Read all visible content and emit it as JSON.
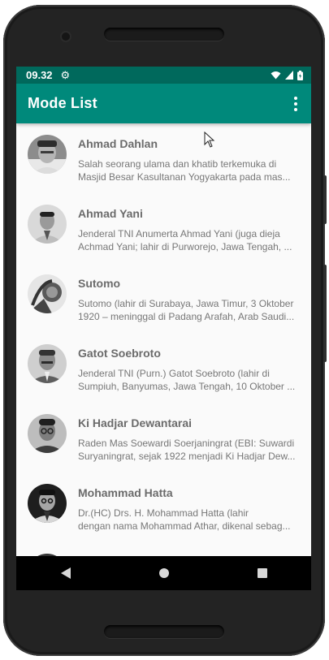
{
  "statusbar": {
    "time": "09.32",
    "icons": [
      "settings-gear-icon",
      "wifi-icon",
      "signal-icon",
      "battery-icon"
    ]
  },
  "appbar": {
    "title": "Mode List",
    "menu_icon": "more-vertical-icon"
  },
  "items": [
    {
      "name": "Ahmad Dahlan",
      "line1": "Salah seorang ulama dan khatib terkemuka di",
      "line2": "Masjid Besar Kasultanan Yogyakarta pada mas..."
    },
    {
      "name": "Ahmad Yani",
      "line1": "Jenderal TNI Anumerta Ahmad Yani (juga dieja",
      "line2": "Achmad Yani; lahir di Purworejo, Jawa Tengah, ..."
    },
    {
      "name": "Sutomo",
      "line1": "Sutomo (lahir di Surabaya, Jawa Timur, 3 Oktober",
      "line2": "1920 – meninggal di Padang Arafah, Arab Saudi..."
    },
    {
      "name": "Gatot Soebroto",
      "line1": "Jenderal TNI (Purn.) Gatot Soebroto (lahir di",
      "line2": "Sumpiuh, Banyumas, Jawa Tengah, 10 Oktober ..."
    },
    {
      "name": "Ki Hadjar Dewantarai",
      "line1": "Raden Mas Soewardi Soerjaningrat (EBI: Suwardi",
      "line2": "Suryaningrat, sejak 1922 menjadi Ki Hadjar Dew..."
    },
    {
      "name": "Mohammad Hatta",
      "line1": "Dr.(HC) Drs. H. Mohammad Hatta (lahir",
      "line2": "dengan nama Mohammad Athar, dikenal sebag..."
    }
  ],
  "navbar": {
    "buttons": [
      "back-icon",
      "home-icon",
      "recents-icon"
    ]
  },
  "colors": {
    "status_bar": "#00695c",
    "app_bar": "#00897b",
    "list_bg": "#fafafa",
    "title_text": "#6b6b6b",
    "desc_text": "#777777"
  }
}
